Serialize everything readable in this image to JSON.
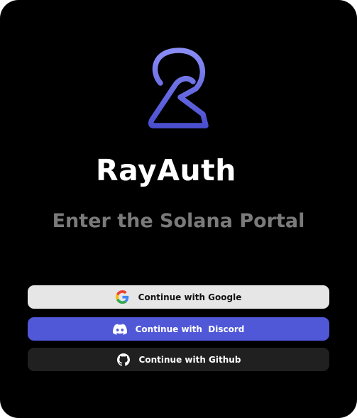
{
  "brand": {
    "name": "RayAuth",
    "logo_icon": "rayauth-logo-icon",
    "accent_color": "#5058d8"
  },
  "subtitle": "Enter the Solana Portal",
  "buttons": {
    "google": {
      "label": "Continue with Google",
      "icon": "google-icon"
    },
    "discord": {
      "label": "Continue with  Discord",
      "icon": "discord-icon"
    },
    "github": {
      "label": "Continue with Github",
      "icon": "github-icon"
    }
  }
}
